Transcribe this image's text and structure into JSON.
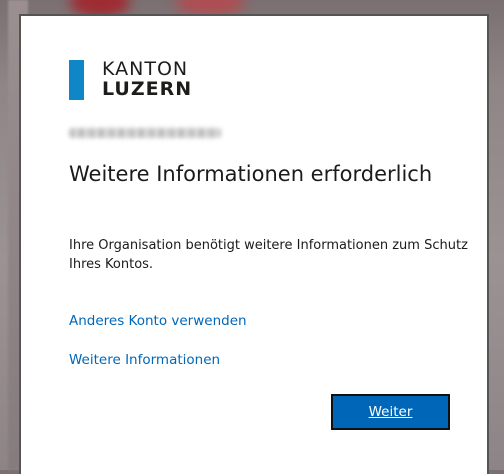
{
  "brand": {
    "line1": "KANTON",
    "line2": "LUZERN",
    "accent_color": "#0f86c8"
  },
  "dialog": {
    "title": "Weitere Informationen erforderlich",
    "description": "Ihre Organisation benötigt weitere Informationen zum Schutz Ihres Kontos.",
    "links": {
      "other_account": "Anderes Konto verwenden",
      "more_info": "Weitere Informationen"
    },
    "next_button_label": "Weiter",
    "link_color": "#0067b8",
    "button_color": "#0067b8"
  }
}
